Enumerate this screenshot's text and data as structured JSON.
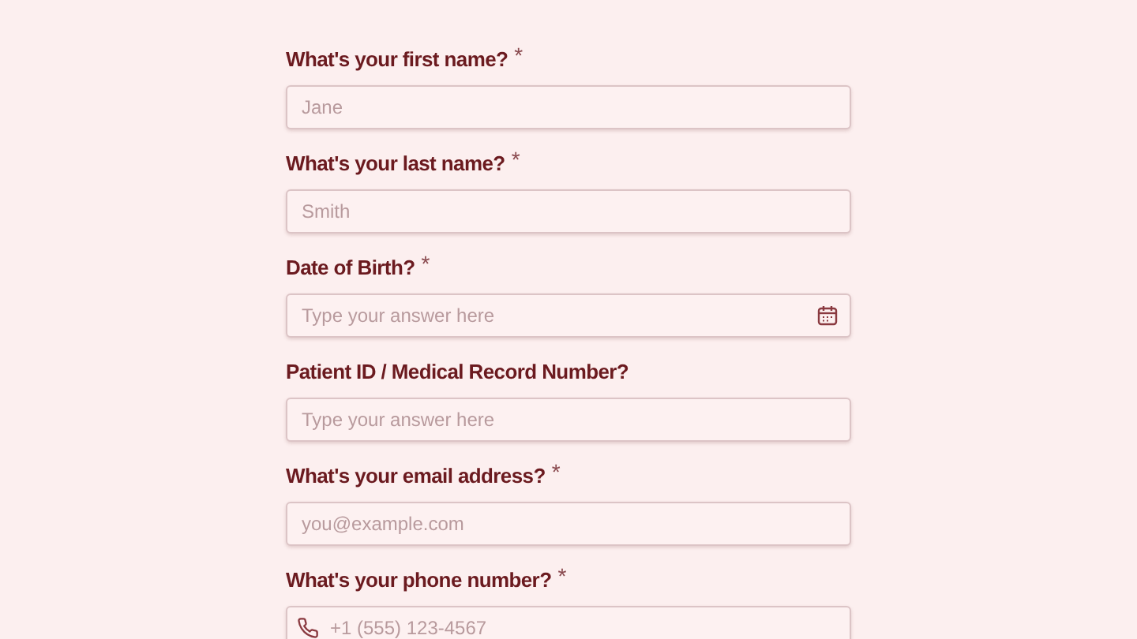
{
  "fields": [
    {
      "kind": "text",
      "label": "What's your first name?",
      "marker": "*",
      "placeholder": "Jane"
    },
    {
      "kind": "text",
      "label": "What's your last name?",
      "marker": "*",
      "placeholder": "Smith"
    },
    {
      "kind": "date",
      "label": "Date of Birth?",
      "marker": "*",
      "placeholder": "Type your answer here"
    },
    {
      "kind": "text",
      "label": "Patient ID / Medical Record Number?",
      "placeholder": "Type your answer here"
    },
    {
      "kind": "email",
      "label": "What's your email address?",
      "marker": "*",
      "placeholder": "you@example.com"
    },
    {
      "kind": "phone",
      "label": "What's your phone number?",
      "marker": "*",
      "placeholder": "+1 (555) 123-4567"
    }
  ]
}
